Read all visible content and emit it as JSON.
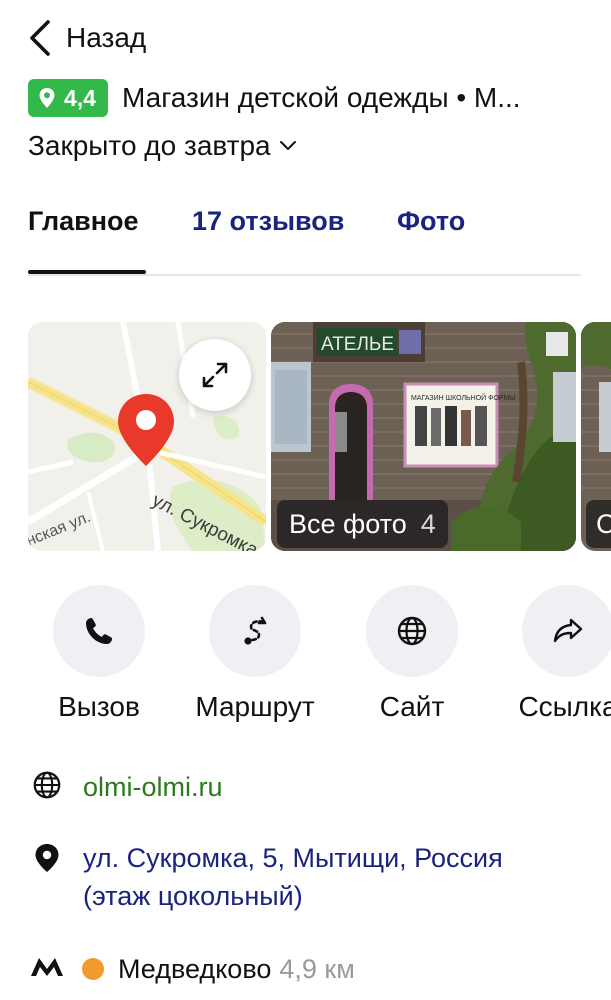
{
  "header": {
    "back_label": "Назад"
  },
  "place": {
    "rating": "4,4",
    "title": "Магазин детской одежды • М...",
    "hours_status": "Закрыто до завтра"
  },
  "tabs": [
    {
      "label": "Главное",
      "active": true
    },
    {
      "label": "17 отзывов",
      "active": false
    },
    {
      "label": "Фото",
      "active": false
    }
  ],
  "map": {
    "street_label": "ул. Сукромка",
    "street_label_2": "нская ул."
  },
  "photos": {
    "all_label": "Все фото",
    "count": "4",
    "next_label_partial": "С"
  },
  "shop_sign": {
    "text": "АТЕЛЬЕ",
    "poster_heading": "МАГАЗИН ШКОЛЬНОЙ ФОРМЫ"
  },
  "actions": [
    {
      "label": "Вызов",
      "icon": "phone-icon"
    },
    {
      "label": "Маршрут",
      "icon": "route-icon"
    },
    {
      "label": "Сайт",
      "icon": "globe-icon"
    },
    {
      "label": "Ссылка",
      "icon": "share-icon"
    }
  ],
  "info": {
    "website": "olmi-olmi.ru",
    "address_line1": "ул. Сукромка, 5, Мытищи, Россия",
    "address_line2": "(этаж цокольный)",
    "metro_name": "Медведково",
    "metro_distance": "4,9 км"
  },
  "colors": {
    "rating_green": "#32b94a",
    "tab_blue": "#1a237e",
    "link_green": "#2d7a1e",
    "metro_orange": "#f39a2c",
    "map_pin_red": "#e8392b"
  }
}
